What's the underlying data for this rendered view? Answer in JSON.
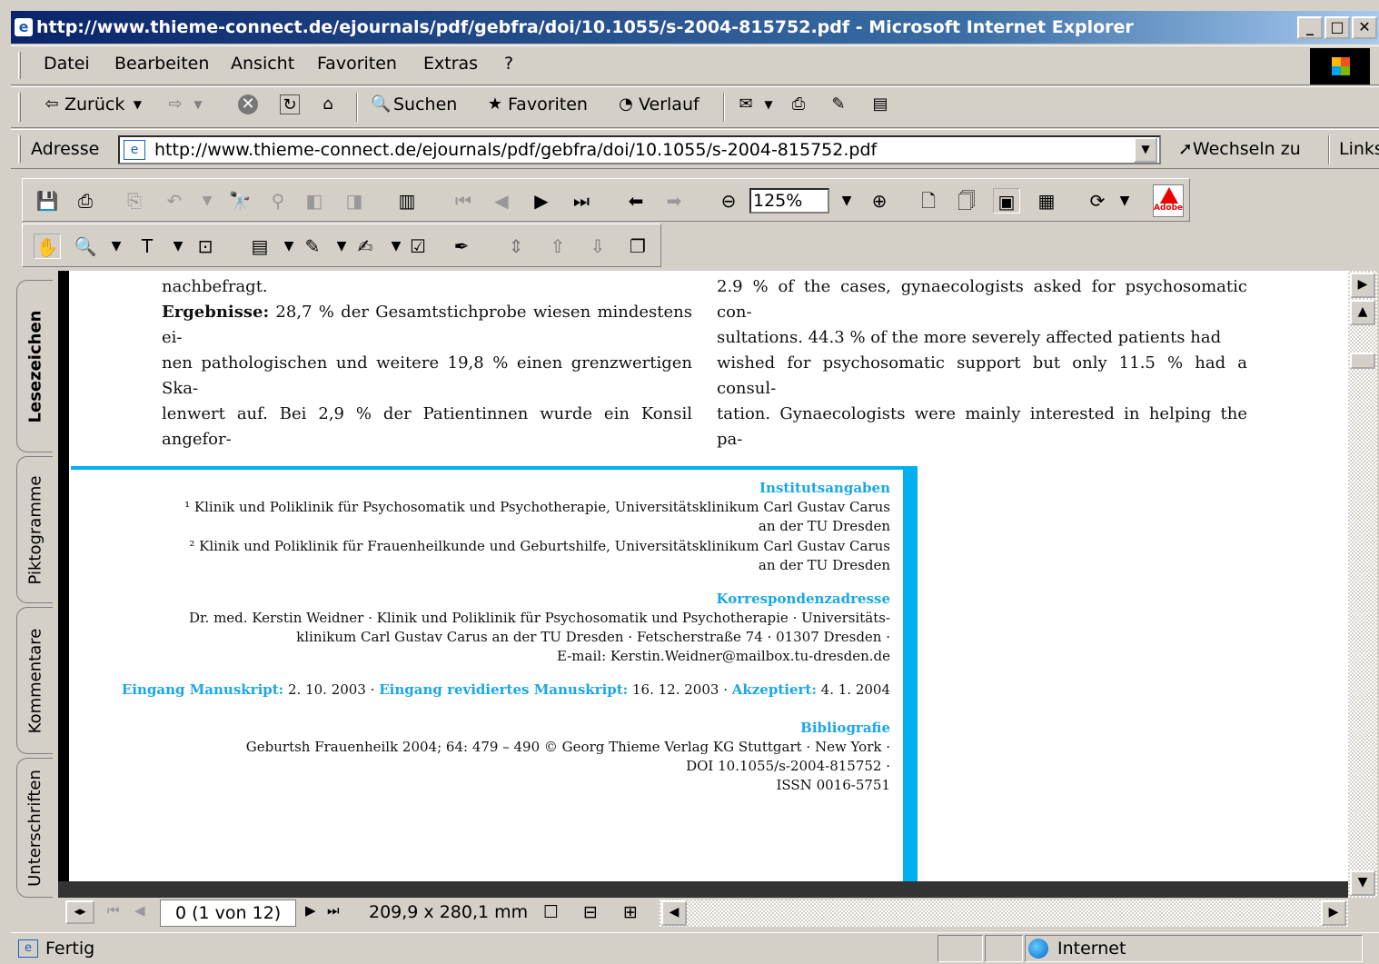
{
  "window": {
    "title": "http://www.thieme-connect.de/ejournals/pdf/gebfra/doi/10.1055/s-2004-815752.pdf - Microsoft Internet Explorer"
  },
  "menu": [
    "Datei",
    "Bearbeiten",
    "Ansicht",
    "Favoriten",
    "Extras",
    "?"
  ],
  "toolbar": {
    "back": "Zurück",
    "search": "Suchen",
    "favorites": "Favoriten",
    "history": "Verlauf"
  },
  "address": {
    "label": "Adresse",
    "url": "http://www.thieme-connect.de/ejournals/pdf/gebfra/doi/10.1055/s-2004-815752.pdf",
    "go": "Wechseln zu",
    "links": "Links"
  },
  "acrobat": {
    "zoom": "125%"
  },
  "side_tabs": [
    "Lesezeichen",
    "Piktogramme",
    "Kommentare",
    "Unterschriften"
  ],
  "doc": {
    "left_lines": [
      "nachbefragt.",
      "28,7 % der Gesamtstichprobe wiesen mindestens ei-",
      "nen pathologischen und weitere 19,8 % einen grenzwertigen Ska-",
      "lenwert auf. Bei 2,9 % der Patientinnen wurde ein Konsil angefor-"
    ],
    "left_bold": "Ergebnisse:",
    "right_lines": [
      "2.9 % of the cases, gynaecologists asked for psychosomatic con-",
      "sultations. 44.3 % of the more severely affected patients had",
      "wished for psychosomatic support but only 11.5 % had a consul-",
      "tation. Gynaecologists were mainly interested in helping the pa-"
    ],
    "inst_heading": "Institutsangaben",
    "inst1a": "¹ Klinik und Poliklinik für Psychosomatik und Psychotherapie, Universitätsklinikum Carl Gustav Carus",
    "inst1b": "an der TU Dresden",
    "inst2a": "² Klinik und Poliklinik für Frauenheilkunde und Geburtshilfe, Universitätsklinikum Carl Gustav Carus",
    "inst2b": "an der TU Dresden",
    "corr_heading": "Korrespondenzadresse",
    "corr1": "Dr. med. Kerstin Weidner · Klinik und Poliklinik für Psychosomatik und Psychotherapie · Universitäts-",
    "corr2": "klinikum Carl Gustav Carus an der TU Dresden · Fetscherstraße 74 · 01307 Dresden ·",
    "corr3": "E-mail: Kerstin.Weidner@mailbox.tu-dresden.de",
    "recv_label": "Eingang Manuskript:",
    "recv_date": "2. 10. 2003",
    "rev_label": "Eingang revidiertes Manuskript:",
    "rev_date": "16. 12. 2003",
    "acc_label": "Akzeptiert:",
    "acc_date": "4. 1. 2004",
    "bib_heading": "Bibliografie",
    "bib1": "Geburtsh Frauenheilk 2004; 64: 479 – 490 © Georg Thieme Verlag KG Stuttgart · New York ·",
    "bib2": "DOI 10.1055/s-2004-815752 ·",
    "bib3": "ISSN 0016-5751"
  },
  "pdfnav": {
    "page": "0 (1 von 12)",
    "size": "209,9 x 280,1 mm"
  },
  "status": {
    "text": "Fertig",
    "zone": "Internet"
  }
}
